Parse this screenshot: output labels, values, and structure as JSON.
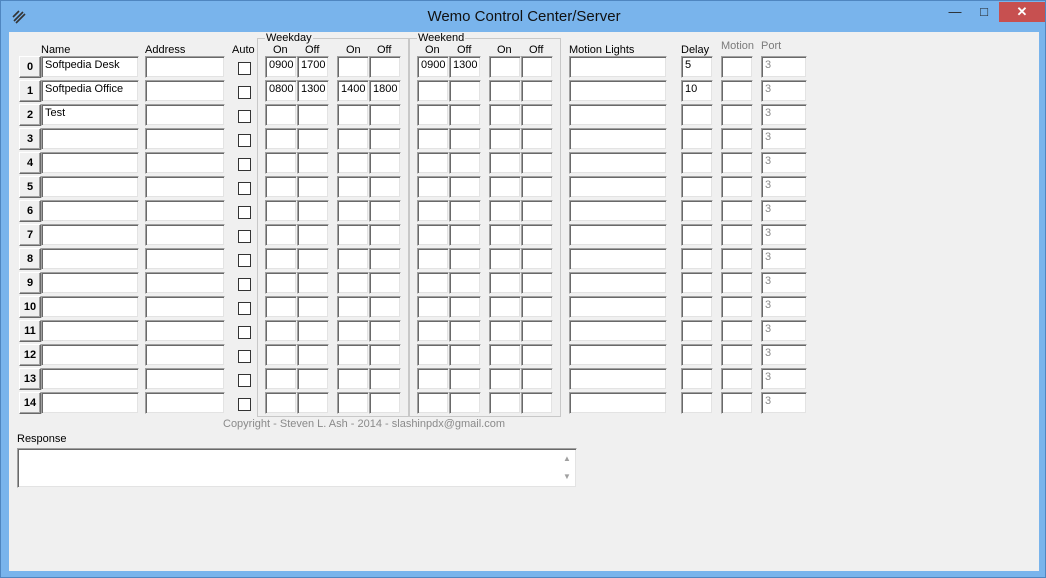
{
  "window": {
    "title": "Wemo Control Center/Server",
    "min_glyph": "—",
    "max_glyph": "□",
    "close_glyph": "✕"
  },
  "headers": {
    "name": "Name",
    "address": "Address",
    "auto": "Auto",
    "weekday": "Weekday",
    "weekend": "Weekend",
    "on": "On",
    "off": "Off",
    "motion_lights": "Motion Lights",
    "delay": "Delay",
    "motion": "Motion",
    "port": "Port"
  },
  "rows": [
    {
      "index": "0",
      "name": "Softpedia Desk",
      "address": "",
      "auto": false,
      "wd_on1": "0900",
      "wd_off1": "1700",
      "wd_on2": "",
      "wd_off2": "",
      "we_on1": "0900",
      "we_off1": "1300",
      "we_on2": "",
      "we_off2": "",
      "motion_lights": "",
      "delay": "5",
      "motion": "",
      "port": "3"
    },
    {
      "index": "1",
      "name": "Softpedia Office",
      "address": "",
      "auto": false,
      "wd_on1": "0800",
      "wd_off1": "1300",
      "wd_on2": "1400",
      "wd_off2": "1800",
      "we_on1": "",
      "we_off1": "",
      "we_on2": "",
      "we_off2": "",
      "motion_lights": "",
      "delay": "10",
      "motion": "",
      "port": "3"
    },
    {
      "index": "2",
      "name": "Test",
      "address": "",
      "auto": false,
      "wd_on1": "",
      "wd_off1": "",
      "wd_on2": "",
      "wd_off2": "",
      "we_on1": "",
      "we_off1": "",
      "we_on2": "",
      "we_off2": "",
      "motion_lights": "",
      "delay": "",
      "motion": "",
      "port": "3"
    },
    {
      "index": "3",
      "name": "",
      "address": "",
      "auto": false,
      "wd_on1": "",
      "wd_off1": "",
      "wd_on2": "",
      "wd_off2": "",
      "we_on1": "",
      "we_off1": "",
      "we_on2": "",
      "we_off2": "",
      "motion_lights": "",
      "delay": "",
      "motion": "",
      "port": "3"
    },
    {
      "index": "4",
      "name": "",
      "address": "",
      "auto": false,
      "wd_on1": "",
      "wd_off1": "",
      "wd_on2": "",
      "wd_off2": "",
      "we_on1": "",
      "we_off1": "",
      "we_on2": "",
      "we_off2": "",
      "motion_lights": "",
      "delay": "",
      "motion": "",
      "port": "3"
    },
    {
      "index": "5",
      "name": "",
      "address": "",
      "auto": false,
      "wd_on1": "",
      "wd_off1": "",
      "wd_on2": "",
      "wd_off2": "",
      "we_on1": "",
      "we_off1": "",
      "we_on2": "",
      "we_off2": "",
      "motion_lights": "",
      "delay": "",
      "motion": "",
      "port": "3"
    },
    {
      "index": "6",
      "name": "",
      "address": "",
      "auto": false,
      "wd_on1": "",
      "wd_off1": "",
      "wd_on2": "",
      "wd_off2": "",
      "we_on1": "",
      "we_off1": "",
      "we_on2": "",
      "we_off2": "",
      "motion_lights": "",
      "delay": "",
      "motion": "",
      "port": "3"
    },
    {
      "index": "7",
      "name": "",
      "address": "",
      "auto": false,
      "wd_on1": "",
      "wd_off1": "",
      "wd_on2": "",
      "wd_off2": "",
      "we_on1": "",
      "we_off1": "",
      "we_on2": "",
      "we_off2": "",
      "motion_lights": "",
      "delay": "",
      "motion": "",
      "port": "3"
    },
    {
      "index": "8",
      "name": "",
      "address": "",
      "auto": false,
      "wd_on1": "",
      "wd_off1": "",
      "wd_on2": "",
      "wd_off2": "",
      "we_on1": "",
      "we_off1": "",
      "we_on2": "",
      "we_off2": "",
      "motion_lights": "",
      "delay": "",
      "motion": "",
      "port": "3"
    },
    {
      "index": "9",
      "name": "",
      "address": "",
      "auto": false,
      "wd_on1": "",
      "wd_off1": "",
      "wd_on2": "",
      "wd_off2": "",
      "we_on1": "",
      "we_off1": "",
      "we_on2": "",
      "we_off2": "",
      "motion_lights": "",
      "delay": "",
      "motion": "",
      "port": "3"
    },
    {
      "index": "10",
      "name": "",
      "address": "",
      "auto": false,
      "wd_on1": "",
      "wd_off1": "",
      "wd_on2": "",
      "wd_off2": "",
      "we_on1": "",
      "we_off1": "",
      "we_on2": "",
      "we_off2": "",
      "motion_lights": "",
      "delay": "",
      "motion": "",
      "port": "3"
    },
    {
      "index": "11",
      "name": "",
      "address": "",
      "auto": false,
      "wd_on1": "",
      "wd_off1": "",
      "wd_on2": "",
      "wd_off2": "",
      "we_on1": "",
      "we_off1": "",
      "we_on2": "",
      "we_off2": "",
      "motion_lights": "",
      "delay": "",
      "motion": "",
      "port": "3"
    },
    {
      "index": "12",
      "name": "",
      "address": "",
      "auto": false,
      "wd_on1": "",
      "wd_off1": "",
      "wd_on2": "",
      "wd_off2": "",
      "we_on1": "",
      "we_off1": "",
      "we_on2": "",
      "we_off2": "",
      "motion_lights": "",
      "delay": "",
      "motion": "",
      "port": "3"
    },
    {
      "index": "13",
      "name": "",
      "address": "",
      "auto": false,
      "wd_on1": "",
      "wd_off1": "",
      "wd_on2": "",
      "wd_off2": "",
      "we_on1": "",
      "we_off1": "",
      "we_on2": "",
      "we_off2": "",
      "motion_lights": "",
      "delay": "",
      "motion": "",
      "port": "3"
    },
    {
      "index": "14",
      "name": "",
      "address": "",
      "auto": false,
      "wd_on1": "",
      "wd_off1": "",
      "wd_on2": "",
      "wd_off2": "",
      "we_on1": "",
      "we_off1": "",
      "we_on2": "",
      "we_off2": "",
      "motion_lights": "",
      "delay": "",
      "motion": "",
      "port": "3"
    }
  ],
  "copyright": "Copyright - Steven L. Ash - 2014 - slashinpdx@gmail.com",
  "response": {
    "label": "Response",
    "value": ""
  }
}
